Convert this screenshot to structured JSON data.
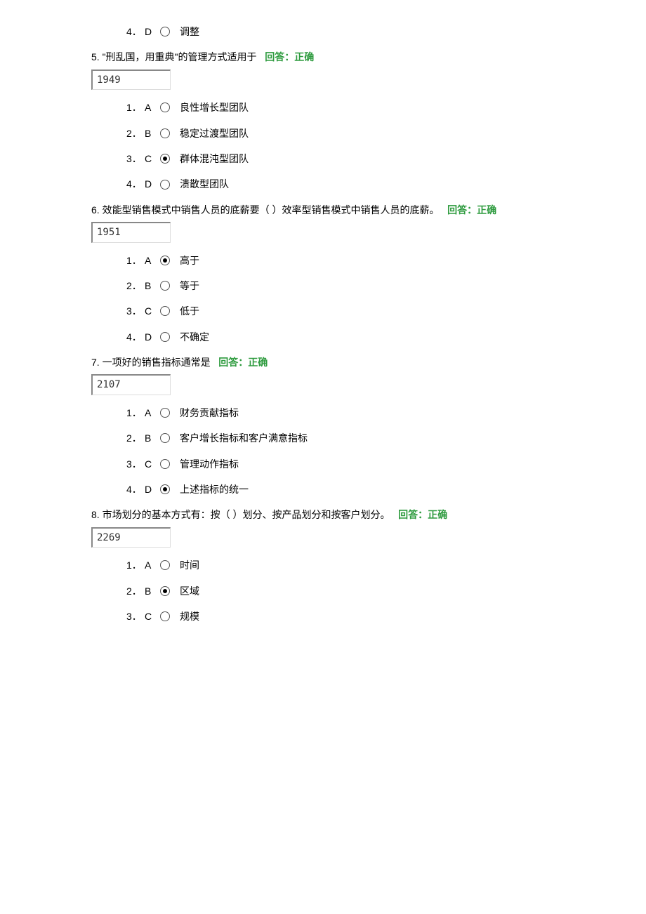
{
  "feedback_label": "回答：正确",
  "options_numbering": [
    "1．",
    "2．",
    "3．",
    "4．"
  ],
  "questions": [
    {
      "num": "4",
      "partial": true,
      "options": [
        {
          "letter": "D",
          "text": "调整",
          "checked": false
        }
      ]
    },
    {
      "num": "5",
      "text": "\"刑乱国，用重典\"的管理方式适用于",
      "id_box": "1949",
      "options": [
        {
          "letter": "A",
          "text": "良性增长型团队",
          "checked": false
        },
        {
          "letter": "B",
          "text": "稳定过渡型团队",
          "checked": false
        },
        {
          "letter": "C",
          "text": "群体混沌型团队",
          "checked": true
        },
        {
          "letter": "D",
          "text": "溃散型团队",
          "checked": false
        }
      ]
    },
    {
      "num": "6",
      "text": "效能型销售模式中销售人员的底薪要（ ）效率型销售模式中销售人员的底薪。",
      "id_box": "1951",
      "options": [
        {
          "letter": "A",
          "text": "高于",
          "checked": true
        },
        {
          "letter": "B",
          "text": "等于",
          "checked": false
        },
        {
          "letter": "C",
          "text": "低于",
          "checked": false
        },
        {
          "letter": "D",
          "text": "不确定",
          "checked": false
        }
      ]
    },
    {
      "num": "7",
      "text": "一项好的销售指标通常是",
      "id_box": "2107",
      "options": [
        {
          "letter": "A",
          "text": "财务贡献指标",
          "checked": false
        },
        {
          "letter": "B",
          "text": "客户增长指标和客户满意指标",
          "checked": false
        },
        {
          "letter": "C",
          "text": "管理动作指标",
          "checked": false
        },
        {
          "letter": "D",
          "text": "上述指标的统一",
          "checked": true
        }
      ]
    },
    {
      "num": "8",
      "text": "市场划分的基本方式有：按（ ）划分、按产品划分和按客户划分。",
      "id_box": "2269",
      "options": [
        {
          "letter": "A",
          "text": "时间",
          "checked": false
        },
        {
          "letter": "B",
          "text": "区域",
          "checked": true
        },
        {
          "letter": "C",
          "text": "规模",
          "checked": false
        }
      ]
    }
  ]
}
